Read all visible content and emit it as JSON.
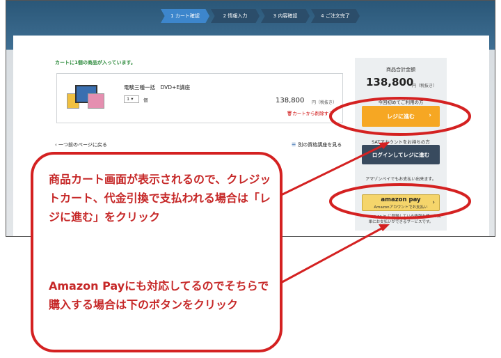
{
  "steps": [
    "1 カート確認",
    "2 情報入力",
    "3 内容確認",
    "4 ご注文完了"
  ],
  "cart": {
    "count_text": "カートに1個の商品が入っています。",
    "item_name": "電験三種一括　DVD+E講座",
    "qty_value": "1",
    "qty_unit": "個",
    "price": "138,800",
    "price_unit": "円（税抜き）",
    "remove_label": "カートから削除する"
  },
  "links": {
    "back": "‹ 一つ前のページに戻る",
    "other": "別の資格講座を見る"
  },
  "summary": {
    "label": "商品合計金額",
    "total": "138,800",
    "total_unit": "円（税抜き）",
    "first_time_label": "今回初めてご利用の方",
    "regi_button": "レジに進む",
    "member_label": "SATアカウントをお持ちの方",
    "login_button": "ログインしてレジに進む",
    "amazon_label": "アマゾンペイでもお支払い出来ます。",
    "amazon_logo": "amazon pay",
    "amazon_sub": "Amazonアカウントでお支払い",
    "amazon_note": "Amazon.co.jp に登録している情報を使って簡単にお支払いができるサービスです。"
  },
  "annotation": {
    "text1": "商品カート画面が表示されるので、クレジットカート、代金引換で支払われる場合は「レジに進む」をクリック",
    "text2": "Amazon Payにも対応してるのでそちらで購入する場合は下のボタンをクリック"
  },
  "colors": {
    "annotation_red": "#d42121",
    "regi_orange": "#f6a723",
    "login_navy": "#384a5e",
    "amazon_yellow": "#f5d56b"
  }
}
